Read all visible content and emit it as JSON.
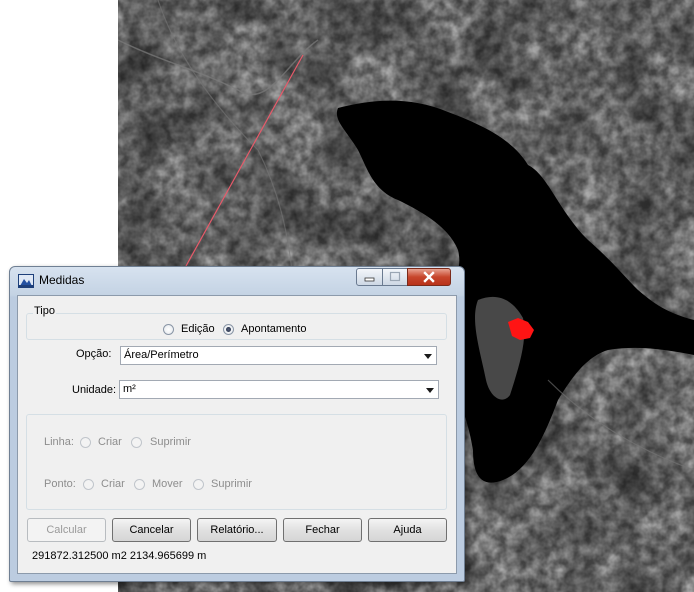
{
  "window": {
    "title": "Medidas"
  },
  "tipo": {
    "legend": "Tipo",
    "options": [
      {
        "label": "Edição",
        "selected": false
      },
      {
        "label": "Apontamento",
        "selected": true
      }
    ]
  },
  "opcao": {
    "label": "Opção:",
    "value": "Área/Perímetro"
  },
  "unidade": {
    "label": "Unidade:",
    "value": "m²"
  },
  "linha": {
    "label": "Linha:",
    "criar": "Criar",
    "suprimir": "Suprimir"
  },
  "ponto": {
    "label": "Ponto:",
    "criar": "Criar",
    "mover": "Mover",
    "suprimir": "Suprimir"
  },
  "buttons": {
    "calcular": "Calcular",
    "cancelar": "Cancelar",
    "relatorio": "Relatório...",
    "fechar": "Fechar",
    "ajuda": "Ajuda"
  },
  "status": "291872.312500 m2 2134.965699 m",
  "colors": {
    "highlight_polygon": "#ff1414",
    "measure_line": "#e85a6a",
    "water": "#000000"
  }
}
